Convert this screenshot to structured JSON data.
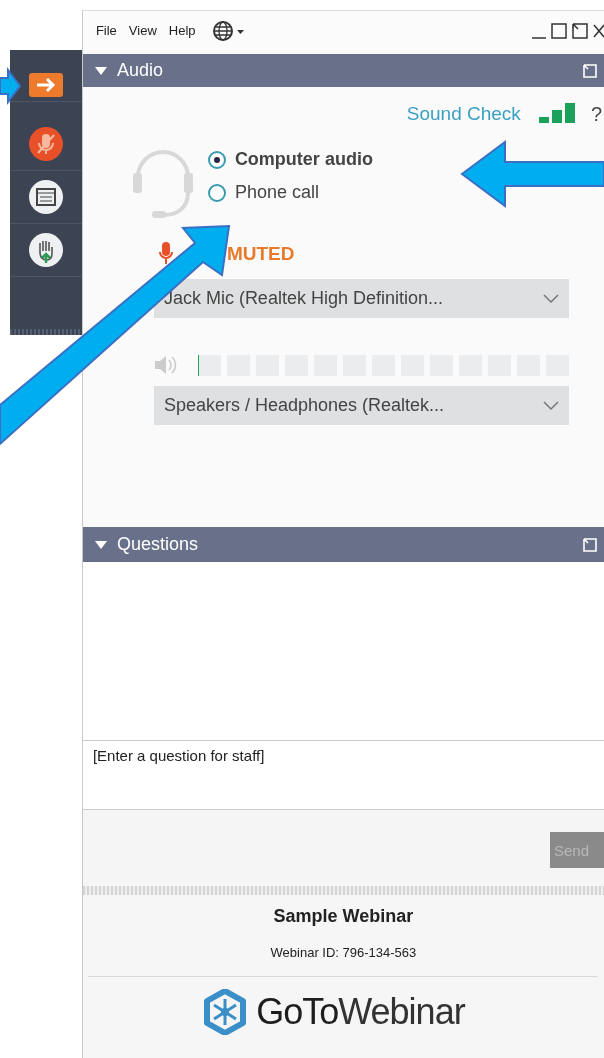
{
  "menu": [
    "File",
    "View",
    "Help"
  ],
  "audio": {
    "title": "Audio",
    "expanded": true,
    "sound_check": "Sound Check",
    "help": "?",
    "options": [
      {
        "label": "Computer audio",
        "selected": true
      },
      {
        "label": "Phone call",
        "selected": false
      }
    ],
    "mic_status": "MUTED",
    "microphone": "Jack Mic (Realtek High Definition...",
    "speaker_meter": {
      "level": 0
    },
    "speaker": "Speakers / Headphones (Realtek..."
  },
  "questions": {
    "title": "Questions",
    "expanded": true,
    "placeholder": "[Enter a question for staff]",
    "send": {
      "label": "Send",
      "disabled": true
    }
  },
  "footer": {
    "title": "Sample Webinar",
    "webinar_id": "Webinar ID: 796-134-563",
    "logo": "**GoTo**Webinar"
  }
}
